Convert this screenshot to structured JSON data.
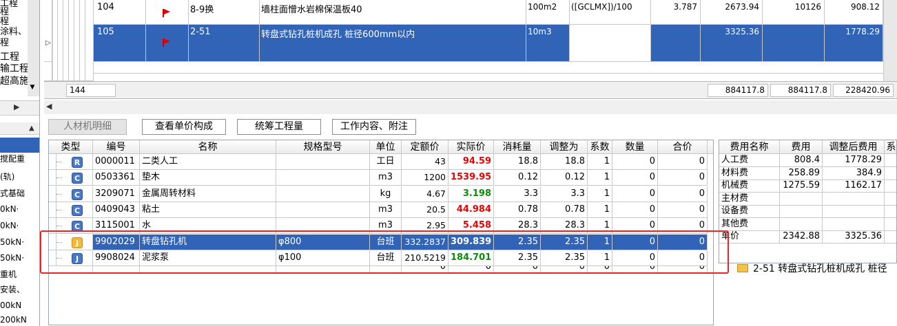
{
  "left_panel": {
    "lines_top": [
      "工程",
      "程",
      "程",
      "涂料、",
      "程",
      "工程",
      "输工程",
      "超高施"
    ],
    "arrow_right": "▶",
    "arrow_up": "▲",
    "lines_bottom": [
      "",
      "搅配重",
      "(轨)",
      "式基础",
      "0kN·",
      "0kN·",
      "50kN·",
      "50kN·",
      "重机",
      "安装、",
      "00kN",
      "200kN"
    ]
  },
  "top_grid": {
    "rows": [
      {
        "num": "104",
        "code": "8-9换",
        "name": "墙柱面憎水岩棉保温板40",
        "unit": "100m2",
        "expr": "([GCLMX])/100",
        "qty": "3.787",
        "price": "2673.94",
        "total": "10126",
        "labor": "908.12",
        "selected": false
      },
      {
        "num": "105",
        "code": "2-51",
        "name": "转盘式钻孔桩机成孔 桩径600mm以内",
        "unit": "10m3",
        "expr": "",
        "qty": "",
        "price": "3325.36",
        "total": "",
        "labor": "1778.29",
        "selected": true
      }
    ],
    "row_marker": "▷"
  },
  "summary": {
    "count": "144",
    "sum1": "884117.8",
    "sum2": "884117.8",
    "sum3": "228420.96"
  },
  "hscroll": {
    "left_arrow": "◀"
  },
  "tabs": [
    "人材机明细",
    "查看单价构成",
    "统筹工程量",
    "工作内容、附注"
  ],
  "materials": {
    "headers": [
      "类型",
      "编号",
      "名称",
      "规格型号",
      "单位",
      "定额价",
      "实际价",
      "消耗量",
      "调整为",
      "系数",
      "数量",
      "合价"
    ],
    "rows": [
      {
        "type": "R",
        "color": "blue",
        "code": "0000011",
        "name": "二类人工",
        "spec": "",
        "unit": "工日",
        "base": "43",
        "actual": "94.59",
        "actual_color": "red",
        "cons": "18.8",
        "adj": "18.8",
        "coef": "1",
        "qty": "0",
        "total": "0"
      },
      {
        "type": "C",
        "color": "blue",
        "code": "0503361",
        "name": "垫木",
        "spec": "",
        "unit": "m3",
        "base": "1200",
        "actual": "1539.95",
        "actual_color": "red",
        "cons": "0.12",
        "adj": "0.12",
        "coef": "1",
        "qty": "0",
        "total": "0"
      },
      {
        "type": "C",
        "color": "blue",
        "code": "3209071",
        "name": "金属周转材料",
        "spec": "",
        "unit": "kg",
        "base": "4.67",
        "actual": "3.198",
        "actual_color": "green",
        "cons": "3.3",
        "adj": "3.3",
        "coef": "1",
        "qty": "0",
        "total": "0"
      },
      {
        "type": "C",
        "color": "blue",
        "code": "0409043",
        "name": "粘土",
        "spec": "",
        "unit": "m3",
        "base": "20.5",
        "actual": "44.984",
        "actual_color": "red",
        "cons": "0.78",
        "adj": "0.78",
        "coef": "1",
        "qty": "0",
        "total": "0"
      },
      {
        "type": "C",
        "color": "blue",
        "code": "3115001",
        "name": "水",
        "spec": "",
        "unit": "m3",
        "base": "2.95",
        "actual": "5.458",
        "actual_color": "red",
        "cons": "28.3",
        "adj": "28.3",
        "coef": "1",
        "qty": "0",
        "total": "0"
      },
      {
        "type": "J",
        "color": "yellow",
        "code": "9902029",
        "name": "转盘钻孔机",
        "spec": "φ800",
        "unit": "台班",
        "base": "332.2837",
        "actual": "309.839",
        "actual_color": "white",
        "cons": "2.35",
        "adj": "2.35",
        "coef": "1",
        "qty": "0",
        "total": "0",
        "selected": true
      },
      {
        "type": "J",
        "color": "blue",
        "code": "9908024",
        "name": "泥浆泵",
        "spec": "φ100",
        "unit": "台班",
        "base": "210.5219",
        "actual": "184.701",
        "actual_color": "green",
        "cons": "2.35",
        "adj": "2.35",
        "coef": "1",
        "qty": "0",
        "total": "0"
      }
    ],
    "partial_row": {
      "base": "0",
      "actual": "0",
      "cons": "0",
      "adj": "0",
      "coef": "0",
      "qty": "0",
      "total": "0"
    }
  },
  "fees": {
    "headers": [
      "费用名称",
      "费用",
      "调整后费用",
      "系"
    ],
    "rows": [
      {
        "name": "人工费",
        "fee": "808.4",
        "adj": "1778.29"
      },
      {
        "name": "材料费",
        "fee": "258.89",
        "adj": "384.9"
      },
      {
        "name": "机械费",
        "fee": "1275.59",
        "adj": "1162.17"
      },
      {
        "name": "主材费",
        "fee": "",
        "adj": ""
      },
      {
        "name": "设备费",
        "fee": "",
        "adj": ""
      },
      {
        "name": "其他费",
        "fee": "",
        "adj": ""
      },
      {
        "name": "单价",
        "fee": "2342.88",
        "adj": "3325.36"
      }
    ],
    "tree_item": "2-51 转盘式钻孔桩机成孔 桩径"
  }
}
